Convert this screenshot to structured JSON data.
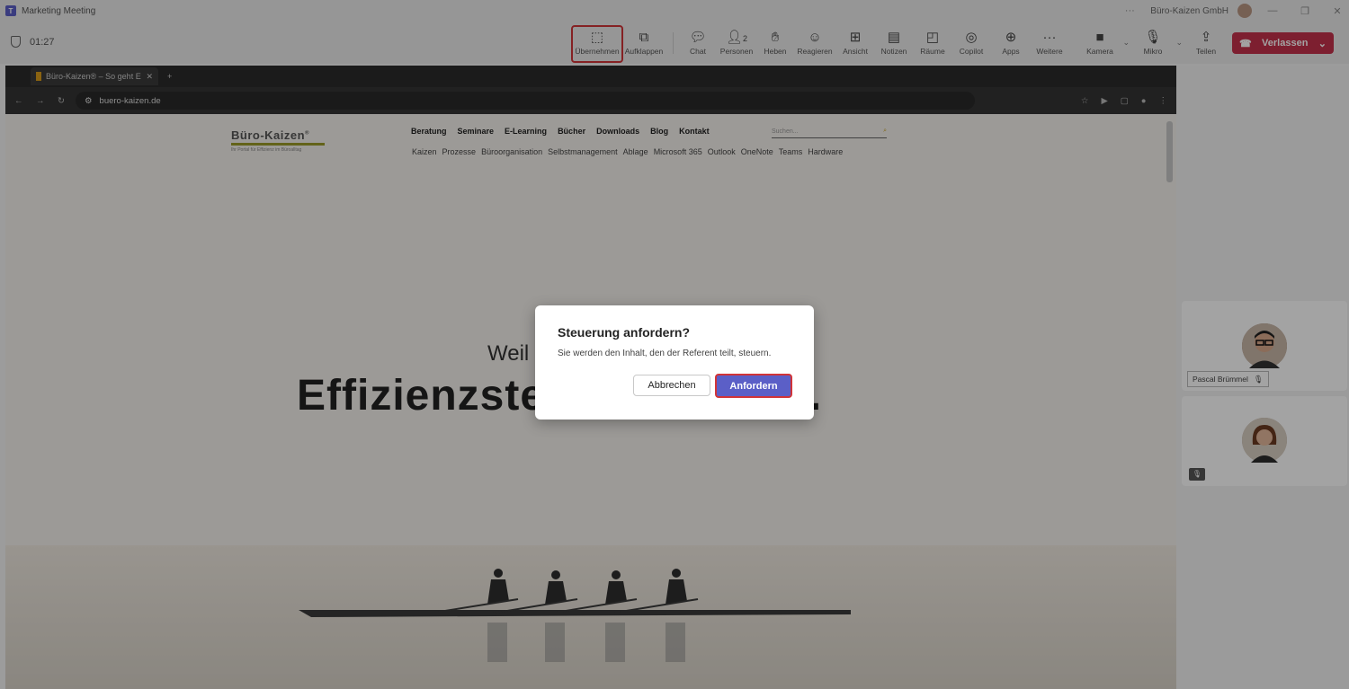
{
  "window": {
    "title": "Marketing Meeting",
    "org": "Büro-Kaizen GmbH"
  },
  "meeting": {
    "timer": "01:27"
  },
  "toolbar": {
    "take_control": "Übernehmen",
    "popout": "Aufklappen",
    "chat": "Chat",
    "people": "Personen",
    "people_count": "2",
    "raise": "Heben",
    "react": "Reagieren",
    "view": "Ansicht",
    "notes": "Notizen",
    "rooms": "Räume",
    "copilot": "Copilot",
    "apps": "Apps",
    "more": "Weitere",
    "camera": "Kamera",
    "mic": "Mikro",
    "share": "Teilen",
    "leave": "Verlassen"
  },
  "browser": {
    "tab_title": "Büro-Kaizen® – So geht Effizi",
    "url": "buero-kaizen.de"
  },
  "website": {
    "logo": "Büro-Kaizen",
    "logo_tm": "®",
    "logo_sub": "Ihr Portal für Effizienz im Büroalltag",
    "main_nav": [
      "Beratung",
      "Seminare",
      "E-Learning",
      "Bücher",
      "Downloads",
      "Blog",
      "Kontakt"
    ],
    "sub_nav": [
      "Kaizen",
      "Prozesse",
      "Büroorganisation",
      "Selbstmanagement",
      "Ablage",
      "Microsoft 365",
      "Outlook",
      "OneNote",
      "Teams",
      "Hardware"
    ],
    "search_placeholder": "Suchen...",
    "headline_1": "Weil",
    "headline_2": "Effizienzstei                ro."
  },
  "participants": [
    {
      "name": "Pascal Brümmel"
    }
  ],
  "dialog": {
    "title": "Steuerung anfordern?",
    "text": "Sie werden den Inhalt, den der Referent teilt, steuern.",
    "cancel": "Abbrechen",
    "confirm": "Anfordern"
  },
  "colors": {
    "teams_accent": "#5b5fc7",
    "leave_red": "#c4314b",
    "highlight_red": "#d13438"
  }
}
